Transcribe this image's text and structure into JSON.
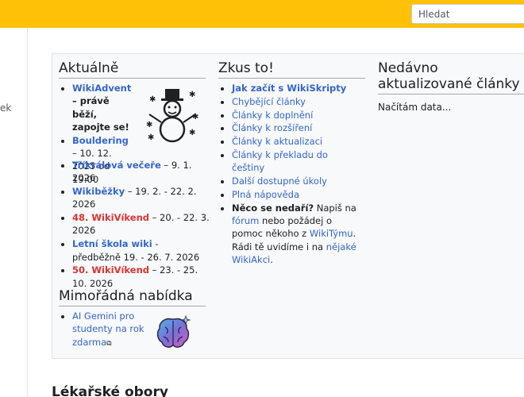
{
  "header": {
    "search_placeholder": "Hledat"
  },
  "sidebar": {
    "fragment": "ek"
  },
  "aktualne": {
    "title": "Aktuálně",
    "items": [
      {
        "link": "WikiAdvent",
        "text": " – právě běží, zapojte se!"
      },
      {
        "link": "Bouldering",
        "text": " – 10. 12. 2025 od 19:00"
      },
      {
        "link": "Tříkrálová večeře",
        "text": " – 9. 1. 2026"
      },
      {
        "link": "Wikiběžky",
        "text": " – 19. 2. - 22. 2. 2026"
      },
      {
        "link": "48. WikiVíkend",
        "text": " – 20. - 22. 3. 2026"
      },
      {
        "link": "Letní škola wiki",
        "text": " - předběžně 19. - 26. 7. 2026"
      },
      {
        "link": "50. WikiVíkend",
        "text": " – 23. - 25. 10. 2026"
      }
    ]
  },
  "nabidka": {
    "title": "Mimořádná nabídka",
    "item": "AI Gemini pro studenty na rok zdarma"
  },
  "zkus": {
    "title": "Zkus to!",
    "items": [
      "Jak začít s WikiSkripty",
      "Chybějící články",
      "Články k doplnění",
      "Články k rozšíření",
      "Články k aktualizaci",
      "Články k překladu do češtiny",
      "Další dostupné úkoly",
      "Plná nápověda"
    ],
    "help": {
      "bold": "Něco se nedaří?",
      "t1": " Napiš na ",
      "l1": "fórum",
      "t2": " nebo požádej o pomoc někoho z ",
      "l2": "WikiTýmu",
      "t3": ". Rádi tě uvidíme i na ",
      "l3": "nějaké WikiAkci",
      "t4": "."
    }
  },
  "nedavno": {
    "title": "Nedávno aktualizované články",
    "loading": "Načítám data..."
  },
  "main": {
    "section_heading": "Lékařské obory"
  },
  "colors": {
    "header": "#ffc107",
    "link": "#3366cc",
    "highlight": "#d33"
  }
}
